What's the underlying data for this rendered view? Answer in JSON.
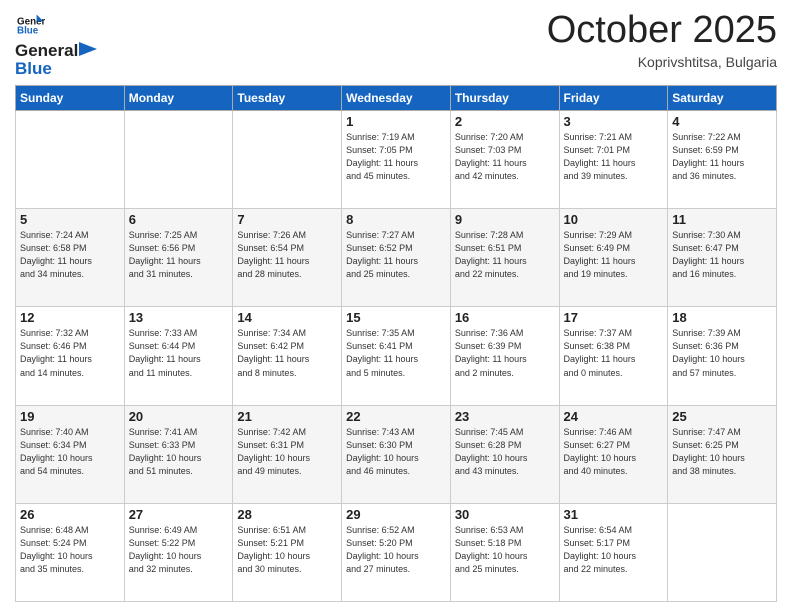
{
  "header": {
    "logo_line1": "General",
    "logo_line2": "Blue",
    "month": "October 2025",
    "location": "Koprivshtitsa, Bulgaria"
  },
  "days_of_week": [
    "Sunday",
    "Monday",
    "Tuesday",
    "Wednesday",
    "Thursday",
    "Friday",
    "Saturday"
  ],
  "weeks": [
    [
      {
        "day": "",
        "content": ""
      },
      {
        "day": "",
        "content": ""
      },
      {
        "day": "",
        "content": ""
      },
      {
        "day": "1",
        "content": "Sunrise: 7:19 AM\nSunset: 7:05 PM\nDaylight: 11 hours\nand 45 minutes."
      },
      {
        "day": "2",
        "content": "Sunrise: 7:20 AM\nSunset: 7:03 PM\nDaylight: 11 hours\nand 42 minutes."
      },
      {
        "day": "3",
        "content": "Sunrise: 7:21 AM\nSunset: 7:01 PM\nDaylight: 11 hours\nand 39 minutes."
      },
      {
        "day": "4",
        "content": "Sunrise: 7:22 AM\nSunset: 6:59 PM\nDaylight: 11 hours\nand 36 minutes."
      }
    ],
    [
      {
        "day": "5",
        "content": "Sunrise: 7:24 AM\nSunset: 6:58 PM\nDaylight: 11 hours\nand 34 minutes."
      },
      {
        "day": "6",
        "content": "Sunrise: 7:25 AM\nSunset: 6:56 PM\nDaylight: 11 hours\nand 31 minutes."
      },
      {
        "day": "7",
        "content": "Sunrise: 7:26 AM\nSunset: 6:54 PM\nDaylight: 11 hours\nand 28 minutes."
      },
      {
        "day": "8",
        "content": "Sunrise: 7:27 AM\nSunset: 6:52 PM\nDaylight: 11 hours\nand 25 minutes."
      },
      {
        "day": "9",
        "content": "Sunrise: 7:28 AM\nSunset: 6:51 PM\nDaylight: 11 hours\nand 22 minutes."
      },
      {
        "day": "10",
        "content": "Sunrise: 7:29 AM\nSunset: 6:49 PM\nDaylight: 11 hours\nand 19 minutes."
      },
      {
        "day": "11",
        "content": "Sunrise: 7:30 AM\nSunset: 6:47 PM\nDaylight: 11 hours\nand 16 minutes."
      }
    ],
    [
      {
        "day": "12",
        "content": "Sunrise: 7:32 AM\nSunset: 6:46 PM\nDaylight: 11 hours\nand 14 minutes."
      },
      {
        "day": "13",
        "content": "Sunrise: 7:33 AM\nSunset: 6:44 PM\nDaylight: 11 hours\nand 11 minutes."
      },
      {
        "day": "14",
        "content": "Sunrise: 7:34 AM\nSunset: 6:42 PM\nDaylight: 11 hours\nand 8 minutes."
      },
      {
        "day": "15",
        "content": "Sunrise: 7:35 AM\nSunset: 6:41 PM\nDaylight: 11 hours\nand 5 minutes."
      },
      {
        "day": "16",
        "content": "Sunrise: 7:36 AM\nSunset: 6:39 PM\nDaylight: 11 hours\nand 2 minutes."
      },
      {
        "day": "17",
        "content": "Sunrise: 7:37 AM\nSunset: 6:38 PM\nDaylight: 11 hours\nand 0 minutes."
      },
      {
        "day": "18",
        "content": "Sunrise: 7:39 AM\nSunset: 6:36 PM\nDaylight: 10 hours\nand 57 minutes."
      }
    ],
    [
      {
        "day": "19",
        "content": "Sunrise: 7:40 AM\nSunset: 6:34 PM\nDaylight: 10 hours\nand 54 minutes."
      },
      {
        "day": "20",
        "content": "Sunrise: 7:41 AM\nSunset: 6:33 PM\nDaylight: 10 hours\nand 51 minutes."
      },
      {
        "day": "21",
        "content": "Sunrise: 7:42 AM\nSunset: 6:31 PM\nDaylight: 10 hours\nand 49 minutes."
      },
      {
        "day": "22",
        "content": "Sunrise: 7:43 AM\nSunset: 6:30 PM\nDaylight: 10 hours\nand 46 minutes."
      },
      {
        "day": "23",
        "content": "Sunrise: 7:45 AM\nSunset: 6:28 PM\nDaylight: 10 hours\nand 43 minutes."
      },
      {
        "day": "24",
        "content": "Sunrise: 7:46 AM\nSunset: 6:27 PM\nDaylight: 10 hours\nand 40 minutes."
      },
      {
        "day": "25",
        "content": "Sunrise: 7:47 AM\nSunset: 6:25 PM\nDaylight: 10 hours\nand 38 minutes."
      }
    ],
    [
      {
        "day": "26",
        "content": "Sunrise: 6:48 AM\nSunset: 5:24 PM\nDaylight: 10 hours\nand 35 minutes."
      },
      {
        "day": "27",
        "content": "Sunrise: 6:49 AM\nSunset: 5:22 PM\nDaylight: 10 hours\nand 32 minutes."
      },
      {
        "day": "28",
        "content": "Sunrise: 6:51 AM\nSunset: 5:21 PM\nDaylight: 10 hours\nand 30 minutes."
      },
      {
        "day": "29",
        "content": "Sunrise: 6:52 AM\nSunset: 5:20 PM\nDaylight: 10 hours\nand 27 minutes."
      },
      {
        "day": "30",
        "content": "Sunrise: 6:53 AM\nSunset: 5:18 PM\nDaylight: 10 hours\nand 25 minutes."
      },
      {
        "day": "31",
        "content": "Sunrise: 6:54 AM\nSunset: 5:17 PM\nDaylight: 10 hours\nand 22 minutes."
      },
      {
        "day": "",
        "content": ""
      }
    ]
  ]
}
